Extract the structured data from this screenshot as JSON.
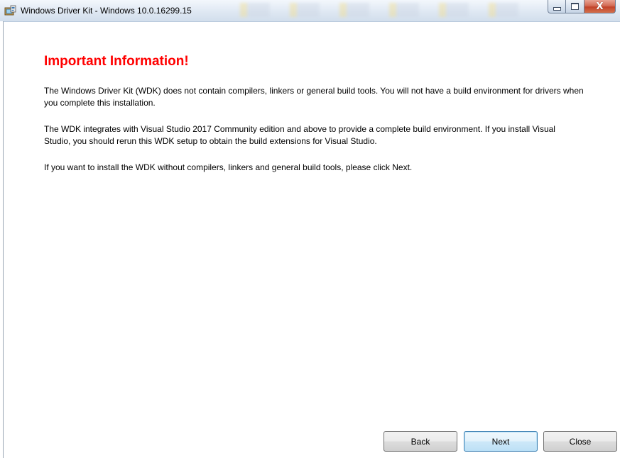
{
  "window": {
    "title": "Windows Driver Kit - Windows 10.0.16299.15",
    "icon": "setup-icon",
    "controls": {
      "minimize": "minimize-icon",
      "maximize": "maximize-icon",
      "close": "close-icon",
      "close_glyph": "X"
    }
  },
  "content": {
    "heading": "Important Information!",
    "paragraphs": [
      "The Windows Driver Kit (WDK) does not contain compilers, linkers or general build tools. You will not have a build environment for drivers when you complete this installation.",
      "The WDK integrates with Visual Studio 2017 Community edition and above to provide a complete build environment. If you install Visual Studio, you should rerun this WDK setup to obtain the build extensions for Visual Studio.",
      "If you want to install the WDK without compilers, linkers and general build tools, please click Next."
    ]
  },
  "buttons": {
    "back": "Back",
    "next": "Next",
    "close": "Close"
  },
  "colors": {
    "heading": "#ff0000",
    "default_button_border": "#3c7fb1"
  }
}
